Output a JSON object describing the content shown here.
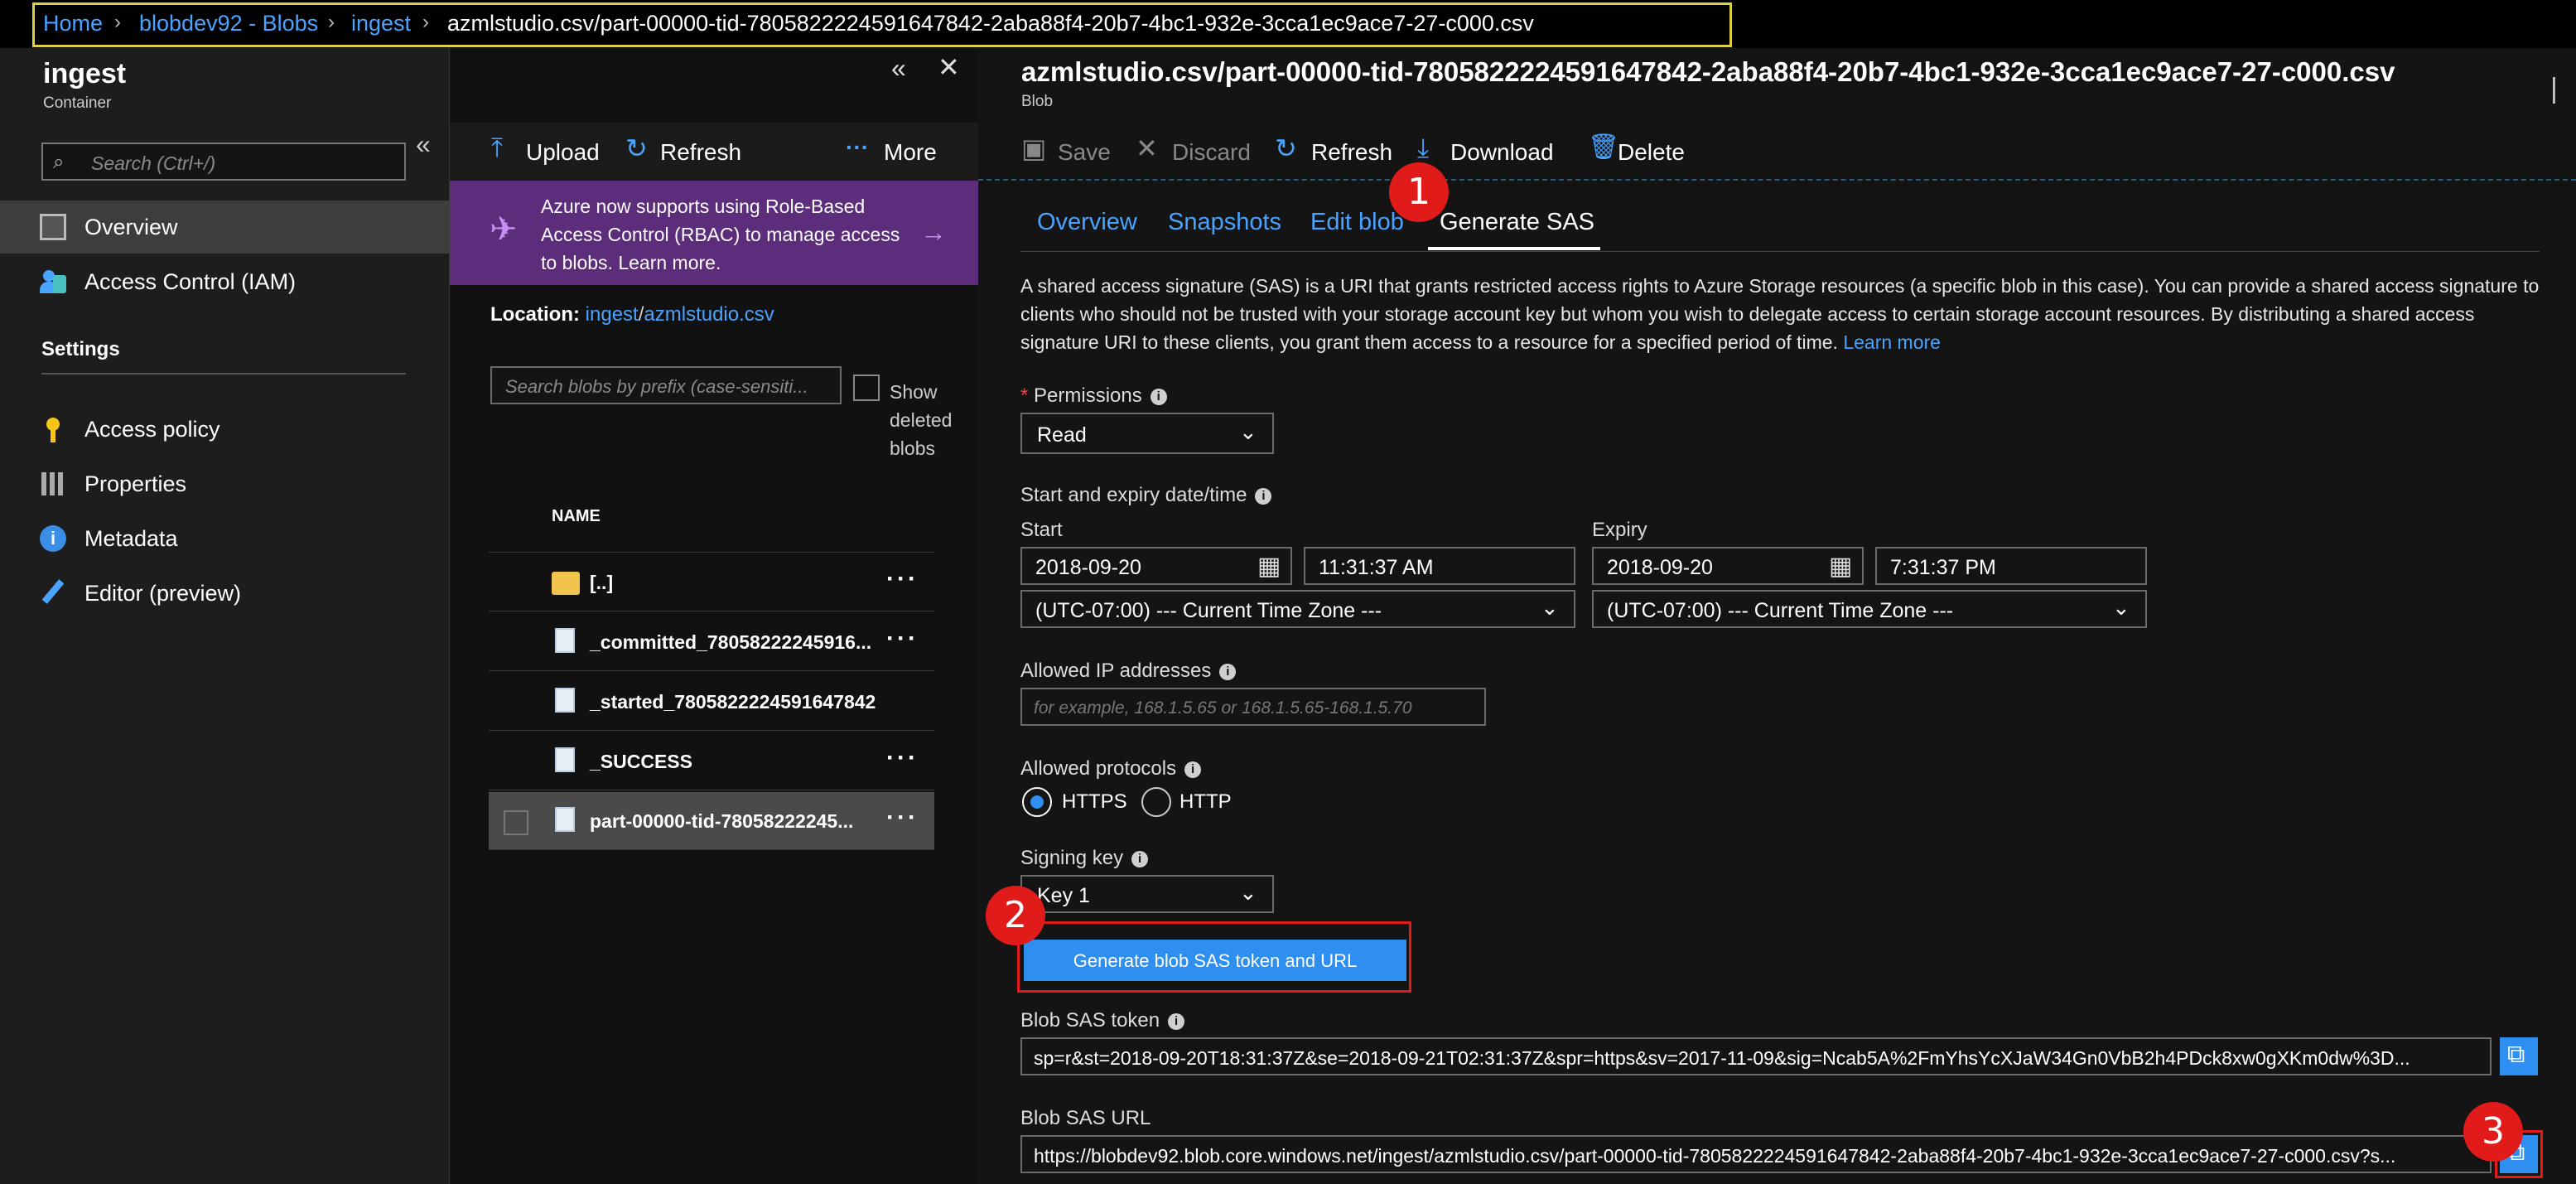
{
  "breadcrumb": {
    "items": [
      "Home",
      "blobdev92 - Blobs",
      "ingest"
    ],
    "current": "azmlstudio.csv/part-00000-tid-7805822224591647842-2aba88f4-20b7-4bc1-932e-3cca1ec9ace7-27-c000.csv"
  },
  "container": {
    "title": "ingest",
    "subtitle": "Container"
  },
  "blob_header": {
    "title": "azmlstudio.csv/part-00000-tid-7805822224591647842-2aba88f4-20b7-4bc1-932e-3cca1ec9ace7-27-c000.csv",
    "subtitle": "Blob"
  },
  "nav": {
    "search_placeholder": "Search (Ctrl+/)",
    "items": [
      "Overview",
      "Access Control (IAM)"
    ],
    "settings_heading": "Settings",
    "settings_items": [
      "Access policy",
      "Properties",
      "Metadata",
      "Editor (preview)"
    ]
  },
  "list_toolbar": {
    "upload": "Upload",
    "refresh": "Refresh",
    "more": "More"
  },
  "rbac_banner": "Azure now supports using Role-Based Access Control (RBAC) to manage access to blobs. Learn more.",
  "location": {
    "label": "Location:",
    "path1": "ingest",
    "sep": "/",
    "path2": "azmlstudio.csv"
  },
  "blob_search_placeholder": "Search blobs by prefix (case-sensiti...",
  "show_deleted": "Show deleted blobs",
  "table": {
    "header": "NAME",
    "rows": [
      "[..]",
      "_committed_78058222245916...",
      "_started_7805822224591647842",
      "_SUCCESS",
      "part-00000-tid-78058222245..."
    ]
  },
  "blob_toolbar": {
    "save": "Save",
    "discard": "Discard",
    "refresh": "Refresh",
    "download": "Download",
    "delete": "Delete"
  },
  "tabs": [
    "Overview",
    "Snapshots",
    "Edit blob",
    "Generate SAS"
  ],
  "description": "A shared access signature (SAS) is a URI that grants restricted access rights to Azure Storage resources (a specific blob in this case). You can provide a shared access signature to clients who should not be trusted with your storage account key but whom you wish to delegate access to certain storage account resources. By distributing a shared access signature URI to these clients, you grant them access to a resource for a specified period of time.",
  "learn_more": "Learn more",
  "form": {
    "permissions_label": "Permissions",
    "permissions_value": "Read",
    "date_label": "Start and expiry date/time",
    "start_label": "Start",
    "start_date": "2018-09-20",
    "start_time": "11:31:37 AM",
    "expiry_label": "Expiry",
    "expiry_date": "2018-09-20",
    "expiry_time": "7:31:37 PM",
    "timezone": "(UTC-07:00) --- Current Time Zone ---",
    "ip_label": "Allowed IP addresses",
    "ip_placeholder": "for example, 168.1.5.65 or 168.1.5.65-168.1.5.70",
    "protocols_label": "Allowed protocols",
    "protocol_https": "HTTPS",
    "protocol_http": "HTTP",
    "signing_label": "Signing key",
    "signing_value": "Key 1",
    "generate_button": "Generate blob SAS token and URL",
    "token_label": "Blob SAS token",
    "token_value": "sp=r&st=2018-09-20T18:31:37Z&se=2018-09-21T02:31:37Z&spr=https&sv=2017-11-09&sig=Ncab5A%2FmYhsYcXJaW34Gn0VbB2h4PDck8xw0gXKm0dw%3D...",
    "url_label": "Blob SAS URL",
    "url_value": "https://blobdev92.blob.core.windows.net/ingest/azmlstudio.csv/part-00000-tid-7805822224591647842-2aba88f4-20b7-4bc1-932e-3cca1ec9ace7-27-c000.csv?s..."
  },
  "callouts": [
    "1",
    "2",
    "3"
  ],
  "colors": {
    "accent": "#4aa3ff",
    "callout": "#e11a1a",
    "banner": "#5c2d7a",
    "highlight": "#e0d040"
  }
}
